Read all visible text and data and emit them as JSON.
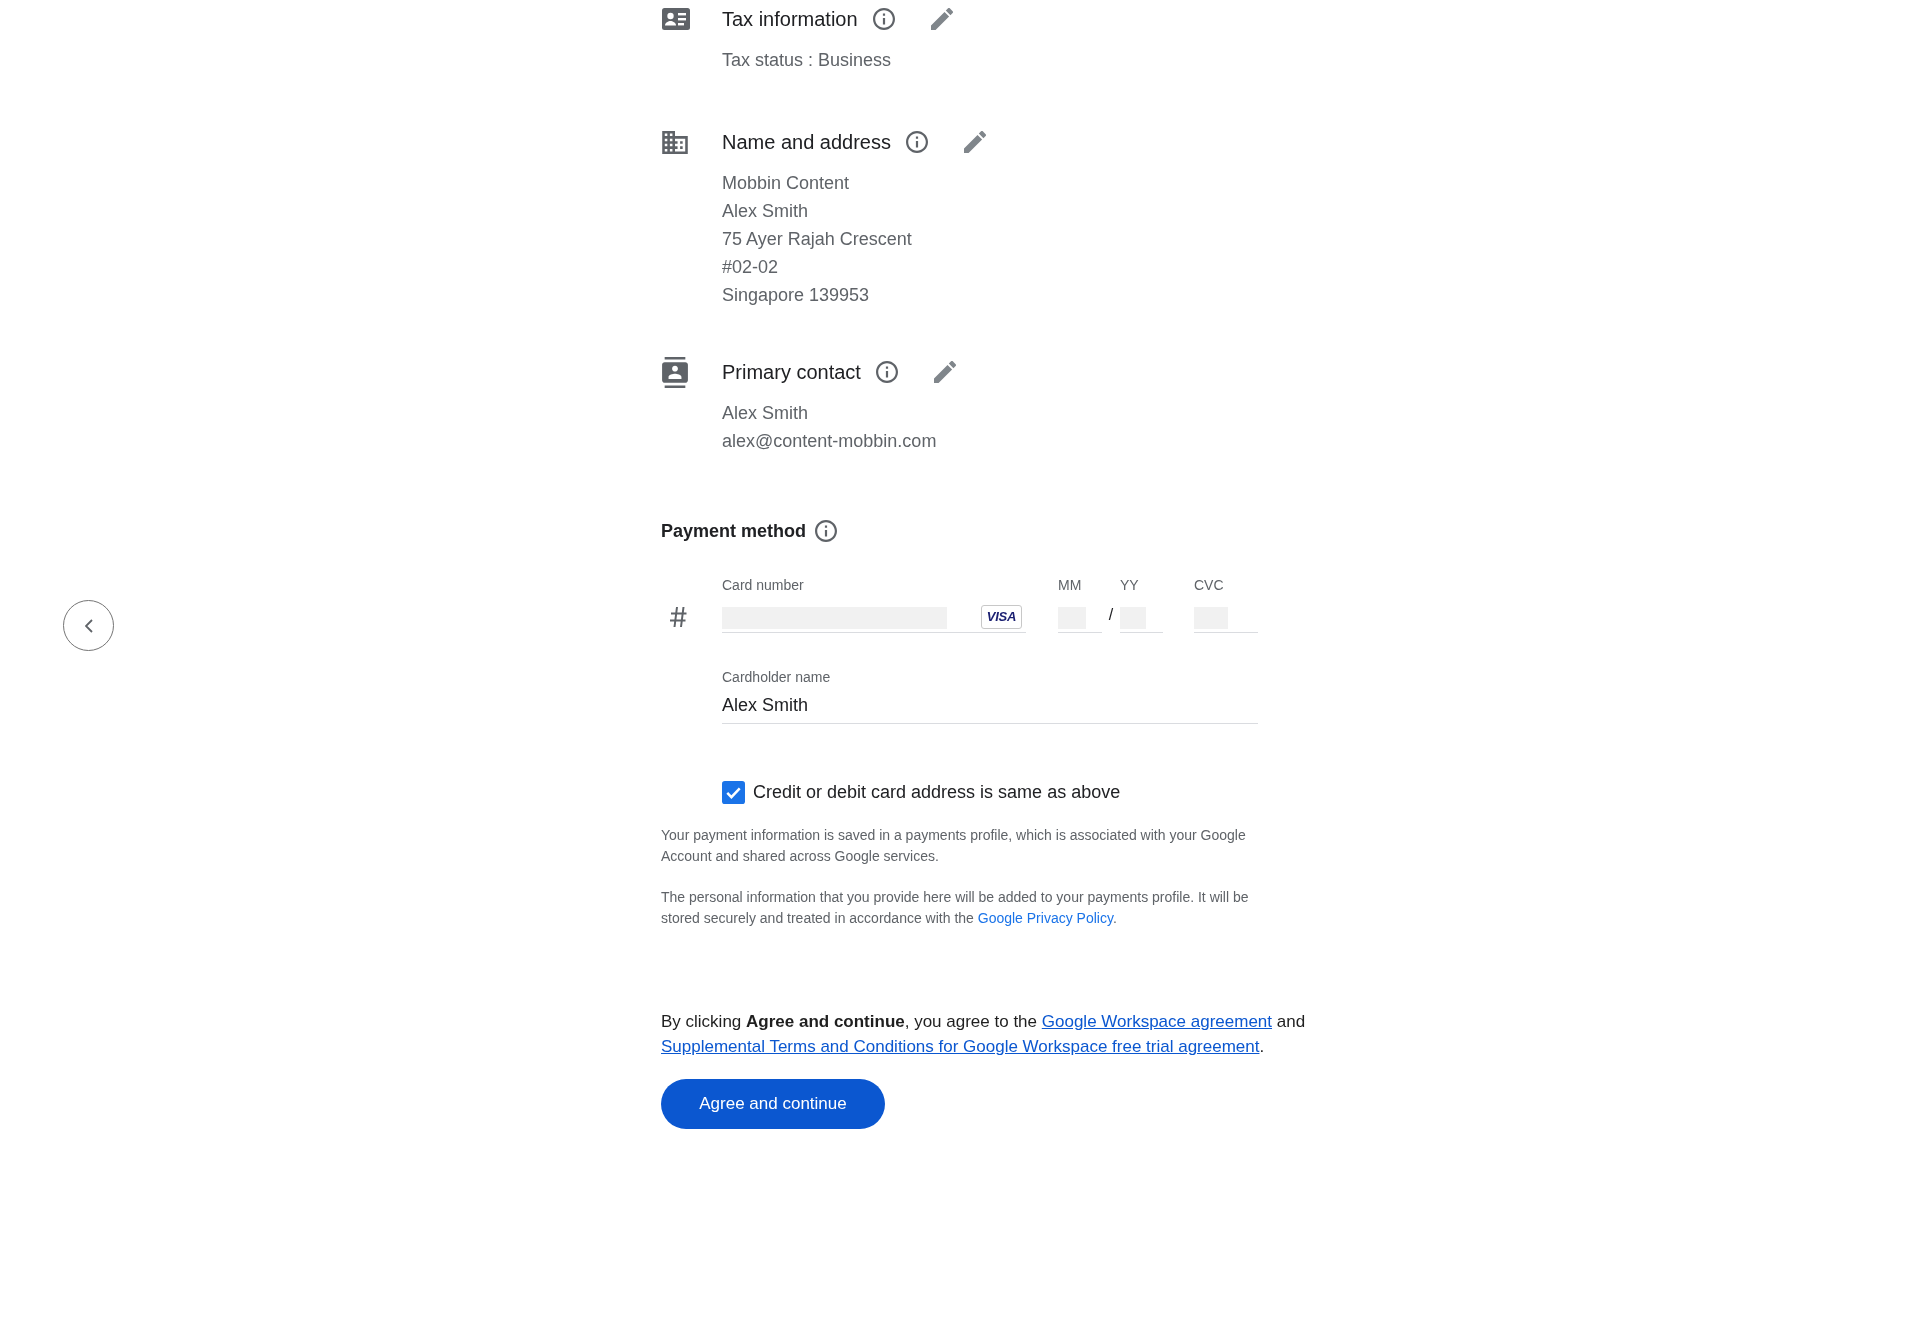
{
  "sections": [
    {
      "kind": "tax",
      "title": "Tax information",
      "lines": [
        "Tax status : Business"
      ]
    },
    {
      "kind": "address",
      "title": "Name and address",
      "lines": [
        "Mobbin Content",
        "Alex Smith",
        "75 Ayer Rajah Crescent",
        "#02-02",
        "Singapore 139953"
      ]
    },
    {
      "kind": "contact",
      "title": "Primary contact",
      "lines": [
        "Alex Smith",
        "alex@content-mobbin.com"
      ]
    }
  ],
  "payment": {
    "title": "Payment method",
    "card_number": {
      "label": "Card number",
      "brand": "VISA"
    },
    "expiry": {
      "month_label": "MM",
      "separator": "/",
      "year_label": "YY"
    },
    "cvc": {
      "label": "CVC"
    },
    "cardholder": {
      "label": "Cardholder name",
      "value": "Alex Smith"
    },
    "same_address": {
      "label": "Credit or debit card address is same as above",
      "checked": true
    }
  },
  "notes": [
    {
      "segments": [
        {
          "kind": "text",
          "text": "Your payment information is saved in a payments profile, which is associated with your Google Account and shared across Google services."
        }
      ]
    },
    {
      "segments": [
        {
          "kind": "text",
          "text": "The personal information that you provide here will be added to your payments profile. It will be stored securely and treated in accordance with the "
        },
        {
          "kind": "link",
          "text": "Google Privacy Policy"
        },
        {
          "kind": "text",
          "text": "."
        }
      ]
    }
  ],
  "agreement": {
    "segments": [
      {
        "kind": "text",
        "text": "By clicking **Agree and continue**, you agree to the "
      },
      {
        "kind": "link",
        "text": "Google Workspace agreement"
      },
      {
        "kind": "text",
        "text": " and "
      },
      {
        "kind": "link",
        "text": "Supplemental Terms and Conditions for Google Workspace free trial agreement"
      },
      {
        "kind": "text",
        "text": "."
      }
    ]
  },
  "button": {
    "label": "Agree and continue"
  }
}
